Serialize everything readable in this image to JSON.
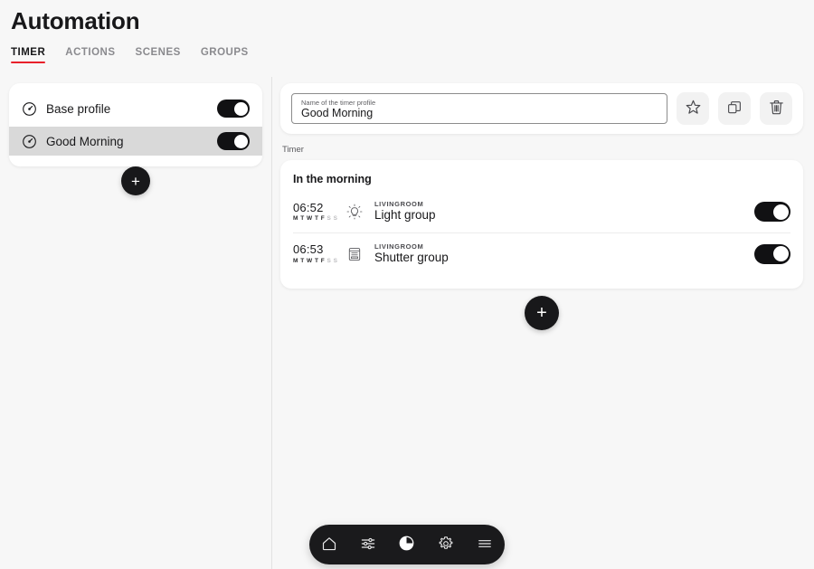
{
  "header": {
    "title": "Automation",
    "tabs": [
      {
        "label": "TIMER",
        "active": true
      },
      {
        "label": "ACTIONS",
        "active": false
      },
      {
        "label": "SCENES",
        "active": false
      },
      {
        "label": "GROUPS",
        "active": false
      }
    ]
  },
  "sidebar": {
    "add_button_label": "+",
    "profiles": [
      {
        "name": "Base profile",
        "icon": "timer-circle-icon",
        "enabled": true,
        "selected": false,
        "toggle_state": "on"
      },
      {
        "name": "Good Morning",
        "icon": "timer-circle-icon",
        "enabled": true,
        "selected": true,
        "toggle_state": "on"
      }
    ]
  },
  "main": {
    "profile_name_field": {
      "label": "Name of the timer profile",
      "value": "Good Morning",
      "placeholder": "Name of the timer profile"
    },
    "actions": [
      {
        "name": "favorite",
        "icon": "star-icon"
      },
      {
        "name": "duplicate",
        "icon": "copy-icon"
      },
      {
        "name": "delete",
        "icon": "trash-icon"
      }
    ],
    "section_label": "Timer",
    "timer_group": {
      "title": "In the morning",
      "entries": [
        {
          "time": "06:52",
          "days": [
            {
              "letter": "M",
              "active": true
            },
            {
              "letter": "T",
              "active": true
            },
            {
              "letter": "W",
              "active": true
            },
            {
              "letter": "T",
              "active": true
            },
            {
              "letter": "F",
              "active": true
            },
            {
              "letter": "S",
              "active": false
            },
            {
              "letter": "S",
              "active": false
            }
          ],
          "icon": "light-bulb-icon",
          "room": "LIVINGROOM",
          "device": "Light group",
          "toggle_state": "on"
        },
        {
          "time": "06:53",
          "days": [
            {
              "letter": "M",
              "active": true
            },
            {
              "letter": "T",
              "active": true
            },
            {
              "letter": "W",
              "active": true
            },
            {
              "letter": "T",
              "active": true
            },
            {
              "letter": "F",
              "active": true
            },
            {
              "letter": "S",
              "active": false
            },
            {
              "letter": "S",
              "active": false
            }
          ],
          "icon": "shutter-icon",
          "room": "LIVINGROOM",
          "device": "Shutter group",
          "toggle_state": "on"
        }
      ]
    },
    "add_timer_button_label": "+"
  },
  "bottom_nav": {
    "items": [
      {
        "name": "home",
        "icon": "house-icon",
        "active": false
      },
      {
        "name": "controls",
        "icon": "sliders-icon",
        "active": false
      },
      {
        "name": "timer",
        "icon": "clock-pie-icon",
        "active": true
      },
      {
        "name": "settings",
        "icon": "gear-icon",
        "active": false
      },
      {
        "name": "menu",
        "icon": "hamburger-icon",
        "active": false
      }
    ]
  },
  "colors": {
    "accent": "#e8202a",
    "page_background": "#f7f7f7",
    "card_background": "#ffffff",
    "toggle_on": "#111113",
    "selected_row": "#d9d9d9",
    "nav_background": "#1a1a1c"
  }
}
